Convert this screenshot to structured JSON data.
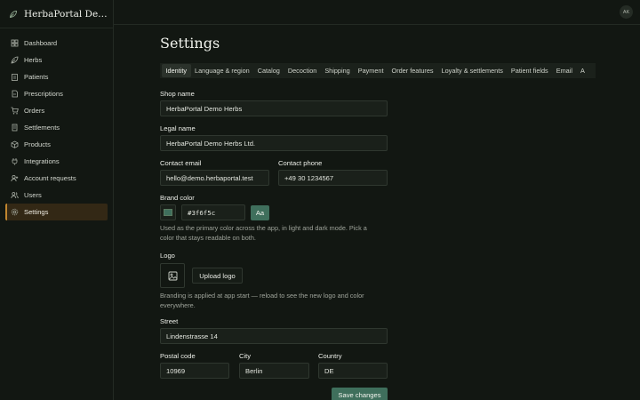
{
  "app": {
    "name": "HerbaPortal Demo ...",
    "avatar_initials": "AK"
  },
  "colors": {
    "accent": "#3f6f5c",
    "active_border": "#c0862f"
  },
  "sidebar": {
    "items": [
      {
        "label": "Dashboard",
        "icon": "dashboard-icon"
      },
      {
        "label": "Herbs",
        "icon": "leaf-icon"
      },
      {
        "label": "Patients",
        "icon": "clipboard-icon"
      },
      {
        "label": "Prescriptions",
        "icon": "document-icon"
      },
      {
        "label": "Orders",
        "icon": "cart-icon"
      },
      {
        "label": "Settlements",
        "icon": "receipt-icon"
      },
      {
        "label": "Products",
        "icon": "box-icon"
      },
      {
        "label": "Integrations",
        "icon": "plug-icon"
      },
      {
        "label": "Account requests",
        "icon": "user-plus-icon"
      },
      {
        "label": "Users",
        "icon": "users-icon"
      },
      {
        "label": "Settings",
        "icon": "gear-icon",
        "active": true
      }
    ]
  },
  "page": {
    "title": "Settings"
  },
  "tabs": [
    "Identity",
    "Language & region",
    "Catalog",
    "Decoction",
    "Shipping",
    "Payment",
    "Order features",
    "Loyalty & settlements",
    "Patient fields",
    "Email",
    "A"
  ],
  "form": {
    "shop_name": {
      "label": "Shop name",
      "value": "HerbaPortal Demo Herbs"
    },
    "legal_name": {
      "label": "Legal name",
      "value": "HerbaPortal Demo Herbs Ltd."
    },
    "contact_email": {
      "label": "Contact email",
      "value": "hello@demo.herbaportal.test"
    },
    "contact_phone": {
      "label": "Contact phone",
      "value": "+49 30 1234567"
    },
    "brand_color": {
      "label": "Brand color",
      "value": "#3f6f5c",
      "preview": "Aa",
      "help": "Used as the primary color across the app, in light and dark mode. Pick a color that stays readable on both."
    },
    "logo": {
      "label": "Logo",
      "upload_label": "Upload logo",
      "help": "Branding is applied at app start — reload to see the new logo and color everywhere."
    },
    "street": {
      "label": "Street",
      "value": "Lindenstrasse 14"
    },
    "postal_code": {
      "label": "Postal code",
      "value": "10969"
    },
    "city": {
      "label": "City",
      "value": "Berlin"
    },
    "country": {
      "label": "Country",
      "value": "DE"
    },
    "save_label": "Save changes"
  }
}
